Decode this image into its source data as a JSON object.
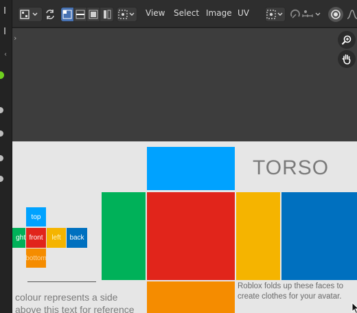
{
  "header": {
    "menus": [
      "View",
      "Select",
      "Image",
      "UV"
    ]
  },
  "icons": {
    "editor_type": "uv-editor-icon",
    "sync": "uv-sync-icon",
    "select_modes": [
      "vertex-select-icon",
      "edge-select-icon",
      "face-select-icon",
      "island-select-icon"
    ],
    "pivot": "pivot-point-icon",
    "snap": "snap-icon",
    "proportional": "proportional-editing-icon",
    "overlay": "overlay-icon",
    "falloff": "falloff-icon",
    "zoom": "zoom-icon",
    "hand": "hand-pan-icon"
  },
  "template": {
    "title": "TORSO",
    "mini_labels": {
      "top": "top",
      "right": "ght",
      "front": "front",
      "left": "left",
      "back": "back",
      "bottom": "bottom"
    },
    "caption_right": [
      "Roblox folds up these faces to",
      "create clothes for your avatar."
    ],
    "caption_left": [
      "colour represents a side",
      "above this text for reference"
    ]
  },
  "colors": {
    "top": "#00a2ff",
    "front": "#e1251b",
    "right": "#00b159",
    "left": "#f5b400",
    "back": "#0070bf",
    "bottom": "#f58c00",
    "accent": "#4772b3"
  }
}
